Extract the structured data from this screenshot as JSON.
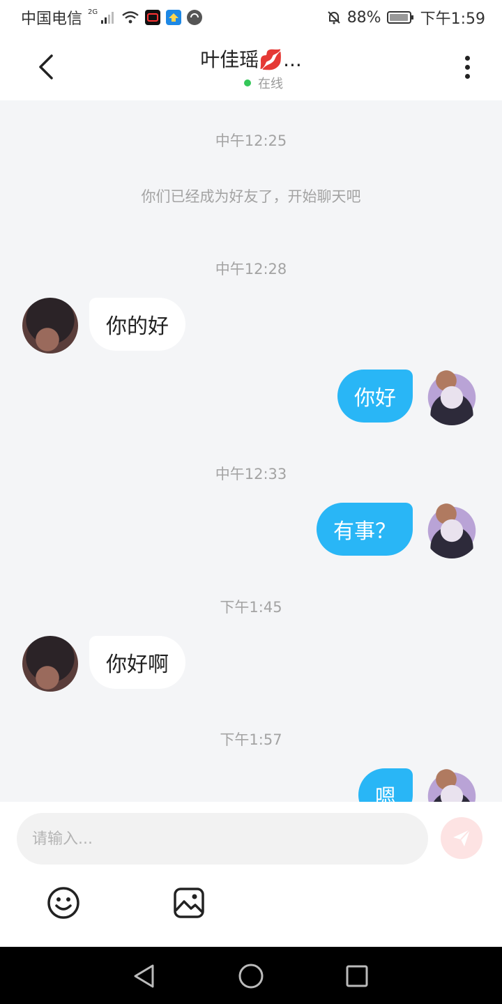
{
  "status_bar": {
    "carrier": "中国电信",
    "network": "2G",
    "battery": "88%",
    "time": "下午1:59",
    "icons": [
      "signal-icon",
      "wifi-icon",
      "app-icon",
      "app-icon",
      "app-icon",
      "mute-icon",
      "battery-icon"
    ]
  },
  "header": {
    "title": "叶佳瑶💋...",
    "status": "在线",
    "status_color": "#34c759"
  },
  "chat": {
    "timestamps": [
      "中午12:25",
      "中午12:28",
      "中午12:33",
      "下午1:45",
      "下午1:57"
    ],
    "system_message": "你们已经成为好友了，开始聊天吧",
    "messages": [
      {
        "side": "in",
        "text": "你的好"
      },
      {
        "side": "out",
        "text": "你好"
      },
      {
        "side": "out",
        "text": "有事？"
      },
      {
        "side": "in",
        "text": "你好啊"
      },
      {
        "side": "out",
        "text": "嗯"
      }
    ],
    "outgoing_color": "#29b6f6"
  },
  "input": {
    "placeholder": "请输入...",
    "value": ""
  },
  "toolbar": {
    "icons": [
      "emoji-icon",
      "image-icon"
    ]
  },
  "nav": {
    "icons": [
      "back-triangle-icon",
      "home-circle-icon",
      "recents-square-icon"
    ]
  }
}
